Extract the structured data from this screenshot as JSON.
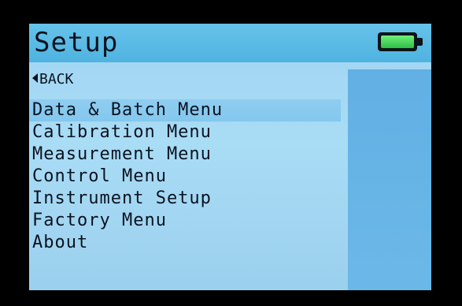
{
  "screen": {
    "title": "Setup",
    "battery_icon": "battery-full-icon",
    "battery_level": 1.0
  },
  "back": {
    "label": "BACK",
    "icon": "left-triangle-icon"
  },
  "menu": {
    "items": [
      {
        "label": "Data & Batch Menu",
        "selected": true
      },
      {
        "label": "Calibration Menu",
        "selected": false
      },
      {
        "label": "Measurement Menu",
        "selected": false
      },
      {
        "label": "Control Menu",
        "selected": false
      },
      {
        "label": "Instrument Setup",
        "selected": false
      },
      {
        "label": "Factory Menu",
        "selected": false
      },
      {
        "label": "About",
        "selected": false
      }
    ]
  },
  "colors": {
    "screen_bg": "#a9dcf5",
    "titlebar_bg": "#4fb3e0",
    "panel_bg": "#62b0e4",
    "text": "#0b1320",
    "battery_fill": "#2fbf46"
  }
}
